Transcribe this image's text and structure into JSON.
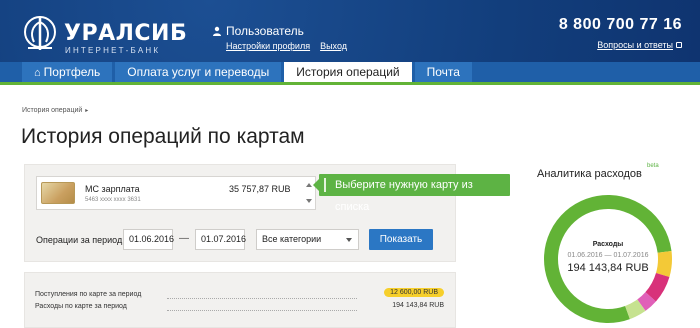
{
  "header": {
    "brand": "УРАЛСИБ",
    "brand_sub": "ИНТЕРНЕТ-БАНК",
    "user_name": "Пользователь",
    "profile_link": "Настройки профиля",
    "logout_link": "Выход",
    "phone": "8 800 700 77 16",
    "help_link": "Вопросы и ответы"
  },
  "nav": {
    "tabs": [
      {
        "label": "Портфель",
        "icon": "home-icon",
        "active": false
      },
      {
        "label": "Оплата услуг и переводы",
        "active": false
      },
      {
        "label": "История операций",
        "active": true
      },
      {
        "label": "Почта",
        "active": false
      }
    ]
  },
  "breadcrumb": {
    "label": "История операций"
  },
  "page_title": "История операций по картам",
  "card": {
    "name": "МС зарплата",
    "amount": "35 757,87 RUB",
    "number": "5463 xxxx xxxx 3631"
  },
  "tooltip": "Выберите нужную карту из списка",
  "filter": {
    "period_label": "Операции за период",
    "date_from": "01.06.2016",
    "date_sep": "—",
    "date_to": "01.07.2016",
    "category": "Все категории",
    "show_button": "Показать"
  },
  "summary": {
    "income_label": "Поступления по карте за период",
    "income_value": "12 600,00 RUB",
    "expense_label": "Расходы по карте за период",
    "expense_value": "194 143,84 RUB"
  },
  "analytics": {
    "title": "Аналитика расходов",
    "beta": "beta",
    "center_label": "Расходы",
    "center_period": "01.06.2016 — 01.07.2016",
    "center_amount": "194 143,84 RUB",
    "segments": [
      {
        "color": "#62b336",
        "share": 0.785
      },
      {
        "color": "#f3c937",
        "share": 0.065
      },
      {
        "color": "#d8317a",
        "share": 0.07
      },
      {
        "color": "#e060b8",
        "share": 0.035
      },
      {
        "color": "#c6e28f",
        "share": 0.045
      }
    ]
  },
  "colors": {
    "header_bg": "#123e7c",
    "nav_bg": "#1f5fa8",
    "accent_green": "#62b336",
    "button_blue": "#2b77c4",
    "badge_yellow": "#f6cf2b"
  }
}
